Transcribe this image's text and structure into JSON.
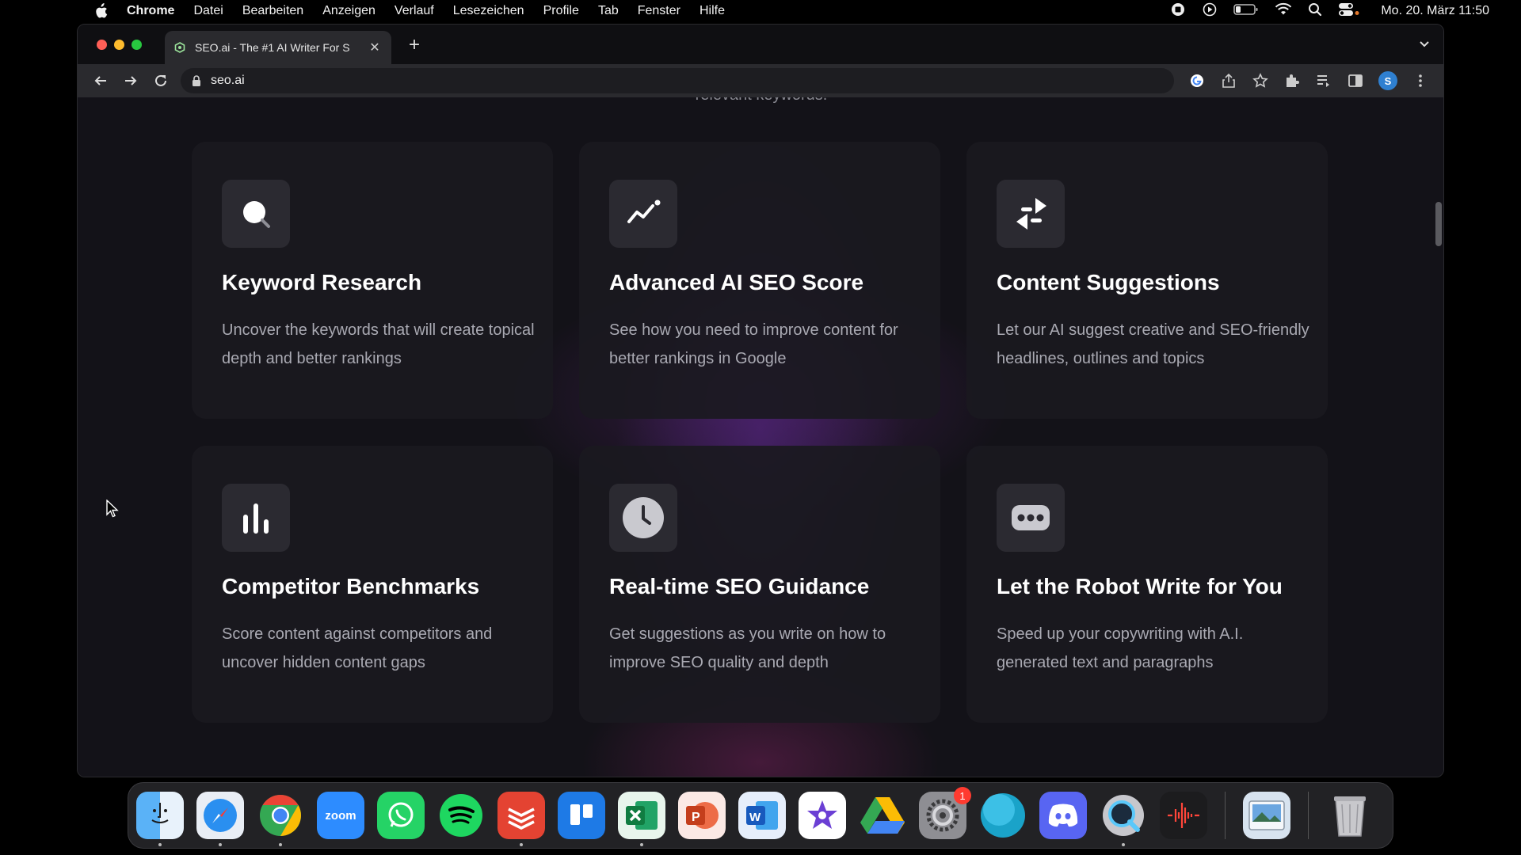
{
  "menubar": {
    "items": [
      "Chrome",
      "Datei",
      "Bearbeiten",
      "Anzeigen",
      "Verlauf",
      "Lesezeichen",
      "Profile",
      "Tab",
      "Fenster",
      "Hilfe"
    ],
    "clock": "Mo. 20. März  11:50"
  },
  "browser": {
    "tab_title": "SEO.ai - The #1 AI Writer For S",
    "url": "seo.ai",
    "profile_initial": "S"
  },
  "page": {
    "heading_partial": "relevant keywords.",
    "features": [
      {
        "icon": "search-icon",
        "title": "Keyword Research",
        "description": "Uncover the keywords that will create topical depth and better rankings"
      },
      {
        "icon": "trend-line-icon",
        "title": "Advanced AI SEO Score",
        "description": "See how you need to improve content for better rankings in Google"
      },
      {
        "icon": "suggestion-icon",
        "title": "Content Suggestions",
        "description": "Let our AI suggest creative and SEO-friendly headlines, outlines and topics"
      },
      {
        "icon": "bar-chart-icon",
        "title": "Competitor Benchmarks",
        "description": "Score content against competitors and uncover hidden content gaps"
      },
      {
        "icon": "clock-icon",
        "title": "Real-time SEO Guidance",
        "description": "Get suggestions as you write on how to improve SEO quality and depth"
      },
      {
        "icon": "robot-icon",
        "title": "Let the Robot Write for You",
        "description": "Speed up your copywriting with A.I. generated text and paragraphs"
      }
    ]
  },
  "dock": {
    "items": [
      "finder-icon",
      "safari-icon",
      "chrome-icon",
      "zoom-icon",
      "whatsapp-icon",
      "spotify-icon",
      "todoist-icon",
      "trello-icon",
      "excel-icon",
      "powerpoint-icon",
      "word-icon",
      "imovie-icon",
      "google-drive-icon",
      "system-settings-icon",
      "browser-globe-icon",
      "discord-icon",
      "quicktime-icon",
      "voice-memo-icon",
      "preview-icon",
      "trash-icon"
    ],
    "zoom_label": "zoom",
    "settings_badge": "1"
  }
}
